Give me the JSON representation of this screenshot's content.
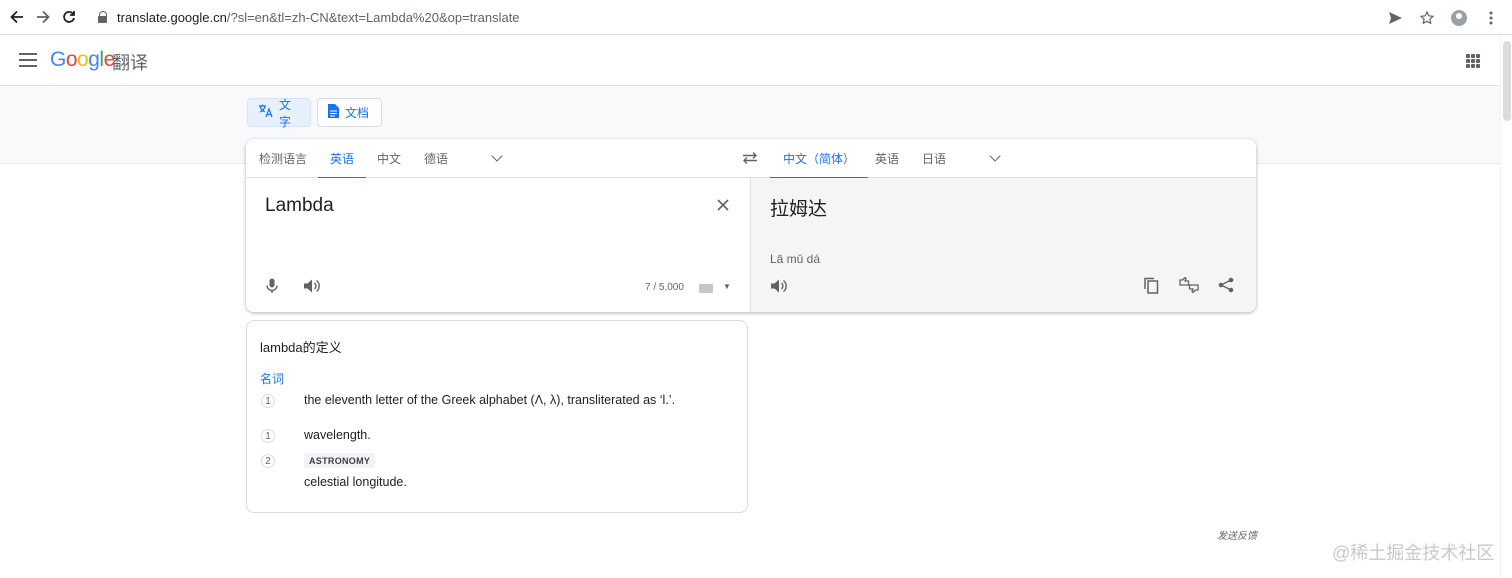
{
  "browser": {
    "url_host": "translate.google.cn",
    "url_path": "/?sl=en&tl=zh-CN&text=Lambda%20&op=translate",
    "icons": [
      "back-icon",
      "forward-icon",
      "reload-icon",
      "lock-icon",
      "send-icon",
      "star-icon",
      "account-icon",
      "menu-icon"
    ]
  },
  "header": {
    "logo": "Google",
    "product": "翻译"
  },
  "modes": {
    "text_label": "文字",
    "doc_label": "文档"
  },
  "source_langs": {
    "detect": "检测语言",
    "english": "英语",
    "chinese": "中文",
    "german": "德语"
  },
  "target_langs": {
    "chinese_simplified": "中文（简体）",
    "english": "英语",
    "japanese": "日语"
  },
  "source": {
    "text": "Lambda",
    "char_count": "7 / 5,000"
  },
  "target": {
    "text": "拉姆达",
    "romanization": "Lā mǔ dá"
  },
  "definitions": {
    "title": "lambda的定义",
    "part_of_speech": "名词",
    "items": [
      {
        "num": "1",
        "text": "the eleventh letter of the Greek alphabet (Λ, λ), transliterated as ‘l.’."
      },
      {
        "num": "1",
        "text": "wavelength."
      },
      {
        "num": "2",
        "label": "ASTRONOMY",
        "text": "celestial longitude."
      }
    ]
  },
  "footer": {
    "feedback": "发送反馈",
    "watermark": "@稀土掘金技术社区"
  },
  "colors": {
    "accent": "#1a73e8",
    "target_bg": "#f5f5f5",
    "band_bg": "#f8f9fa"
  }
}
